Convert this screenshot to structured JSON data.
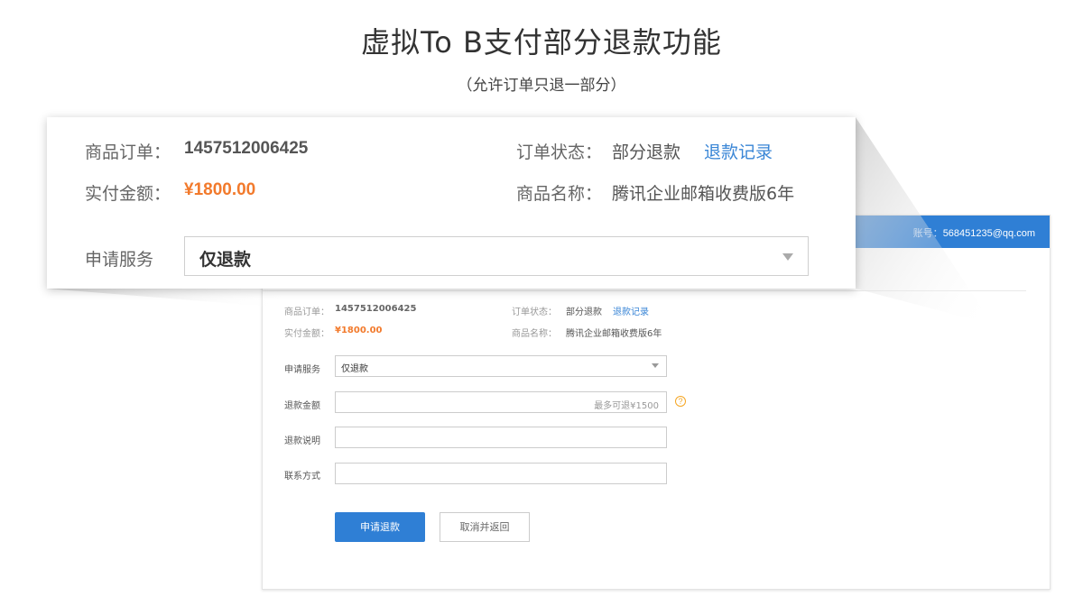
{
  "header": {
    "title": "虚拟To B支付部分退款功能",
    "subtitle": "（允许订单只退一部分）"
  },
  "account": {
    "label": "账号：",
    "email": "568451235@qq.com"
  },
  "order": {
    "order_label": "商品订单：",
    "order_no": "1457512006425",
    "status_label": "订单状态：",
    "status_value": "部分退款",
    "refund_record_link": "退款记录",
    "paid_label": "实付金额：",
    "paid_value": "¥1800.00",
    "product_label": "商品名称：",
    "product_value": "腾讯企业邮箱收费版6年"
  },
  "form": {
    "service_label": "申请服务",
    "service_value": "仅退款",
    "amount_label": "退款金额",
    "amount_placeholder": "最多可退¥1500",
    "help_icon_glyph": "?",
    "reason_label": "退款说明",
    "contact_label": "联系方式",
    "submit_button": "申请退款",
    "cancel_button": "取消并返回"
  },
  "zoom": {
    "order_label": "商品订单：",
    "order_no": "1457512006425",
    "status_label": "订单状态：",
    "status_value": "部分退款",
    "refund_record_link": "退款记录",
    "paid_label": "实付金额：",
    "paid_value": "¥1800.00",
    "product_label": "商品名称：",
    "product_value": "腾讯企业邮箱收费版6年",
    "service_label": "申请服务",
    "service_value": "仅退款"
  },
  "colors": {
    "primary": "#2f7fd5",
    "price": "#f27a2c",
    "link": "#3a86d6",
    "help": "#f5a623"
  },
  "icons": {
    "dropdown": "chevron-down-icon",
    "help": "help-icon"
  }
}
